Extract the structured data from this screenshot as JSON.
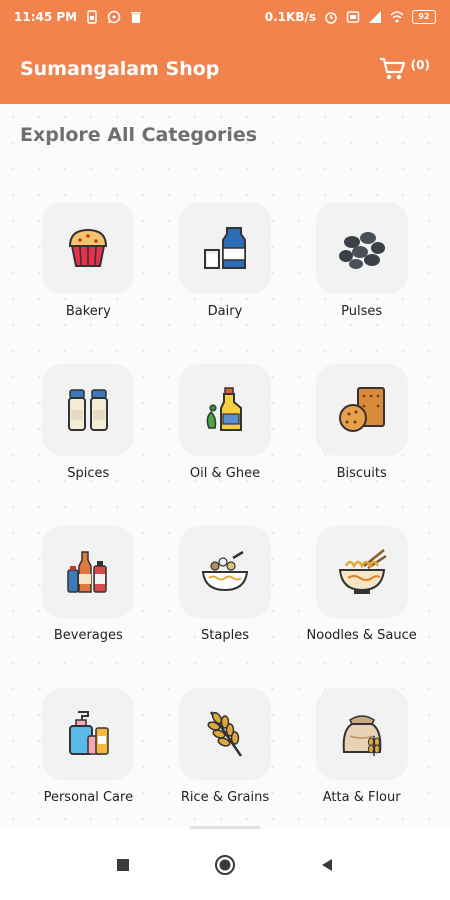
{
  "status_bar": {
    "time": "11:45 PM",
    "network_speed": "0.1KB/s",
    "battery": "92",
    "icons": [
      "sim-icon",
      "whatsapp-icon",
      "trash-icon",
      "alarm-icon",
      "sim-card-icon",
      "signal-icon",
      "wifi-icon",
      "battery-icon"
    ]
  },
  "app_bar": {
    "title": "Sumangalam Shop",
    "cart_count": "(0)",
    "background": "#f3834c"
  },
  "main": {
    "section_title": "Explore All Categories",
    "categories": [
      {
        "label": "Bakery",
        "icon": "cupcake-icon"
      },
      {
        "label": "Dairy",
        "icon": "milk-icon"
      },
      {
        "label": "Pulses",
        "icon": "pulses-icon"
      },
      {
        "label": "Spices",
        "icon": "spice-shakers-icon"
      },
      {
        "label": "Oil & Ghee",
        "icon": "oil-bottle-icon"
      },
      {
        "label": "Biscuits",
        "icon": "biscuit-icon"
      },
      {
        "label": "Beverages",
        "icon": "beverage-bottles-icon"
      },
      {
        "label": "Staples",
        "icon": "staples-bowl-icon"
      },
      {
        "label": "Noodles & Sauce",
        "icon": "noodles-icon"
      },
      {
        "label": "Personal Care",
        "icon": "personal-care-icon"
      },
      {
        "label": "Rice & Grains",
        "icon": "wheat-icon"
      },
      {
        "label": "Atta & Flour",
        "icon": "flour-sack-icon"
      }
    ]
  }
}
